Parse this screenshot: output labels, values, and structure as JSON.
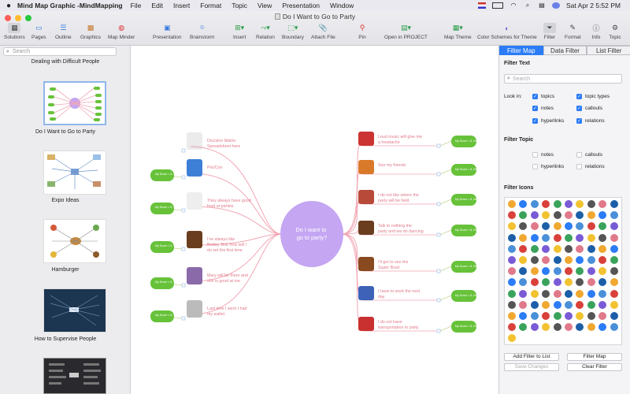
{
  "menubar": {
    "app_name": "Mind Map Graphic -MindMapping",
    "items": [
      "File",
      "Edit",
      "Insert",
      "Format",
      "Topic",
      "View",
      "Presentation",
      "Window"
    ],
    "clock": "Sat Apr 2  5:52 PM"
  },
  "window": {
    "title": "Do I Want to Go to Party"
  },
  "toolbar": {
    "solutions": "Solutions",
    "pages": "Pages",
    "outline": "Outline",
    "graphics": "Graphics",
    "map_minder": "Map Minder",
    "presentation": "Presentation",
    "brainstorm": "Brainstorm",
    "insert": "Insert",
    "relation": "Relation",
    "boundary": "Boundary",
    "attach_file": "Attach File",
    "pin": "Pin",
    "open_in_project": "Open in PROJECT",
    "map_theme": "Map Theme",
    "color_schemes": "Color Schemes for Theme",
    "filter": "Filter",
    "format": "Format",
    "info": "Info",
    "topic": "Topic"
  },
  "sidebar": {
    "search_placeholder": "Search",
    "thumbnails": [
      "Dealing with Difficult People",
      "Do I Want to Go to Party",
      "Expo Ideas",
      "Hamburger",
      "How to Supervise People"
    ]
  },
  "mindmap": {
    "center": "Do I want to go to party?",
    "left_topics": [
      "Decision Matrix Spreadsheet here",
      "Pro/Con",
      "They always have good food at parties",
      "I've always like Bobby. Bob how will I do set the first time",
      "Mary will be there and she is good at me",
      "Last time I went I had my wallet"
    ],
    "right_topics": [
      "Loud music will give me a headache",
      "See my friends",
      "I do not like where the party will be held",
      "Talk to nothing the party and we do dancing",
      "I'll get to see the Super Bowl",
      "I have to work the next day",
      "I do not have transportation to party"
    ],
    "bubble_text": "My Score = 6, Weight = 7"
  },
  "filter_panel": {
    "tabs": [
      "Filter Map",
      "Data Filter",
      "List Filter"
    ],
    "filter_text_heading": "Filter Text",
    "search_placeholder": "Search",
    "look_in_label": "Look in:",
    "look_in": [
      {
        "label": "topics",
        "checked": true
      },
      {
        "label": "topic types",
        "checked": true
      },
      {
        "label": "notes",
        "checked": true
      },
      {
        "label": "callouts",
        "checked": true
      },
      {
        "label": "hyperlinks",
        "checked": true
      },
      {
        "label": "relations",
        "checked": true
      }
    ],
    "filter_topic_heading": "Filter Topic",
    "filter_topic": [
      {
        "label": "notes",
        "checked": false
      },
      {
        "label": "callouts",
        "checked": false
      },
      {
        "label": "hyperlinks",
        "checked": false
      },
      {
        "label": "relations",
        "checked": false
      }
    ],
    "filter_icons_heading": "Filter Icons",
    "buttons": {
      "add_filter": "Add Filter to List",
      "filter_map": "Filter Map",
      "save_changes": "Save Changes",
      "clear_filter": "Clear Filter"
    }
  },
  "colors": {
    "accent": "#2b7cf6",
    "center_node": "#c4a6f2",
    "branch": "#f2a7b4",
    "bubble": "#67c23a",
    "topic_text": "#e07a8a"
  }
}
